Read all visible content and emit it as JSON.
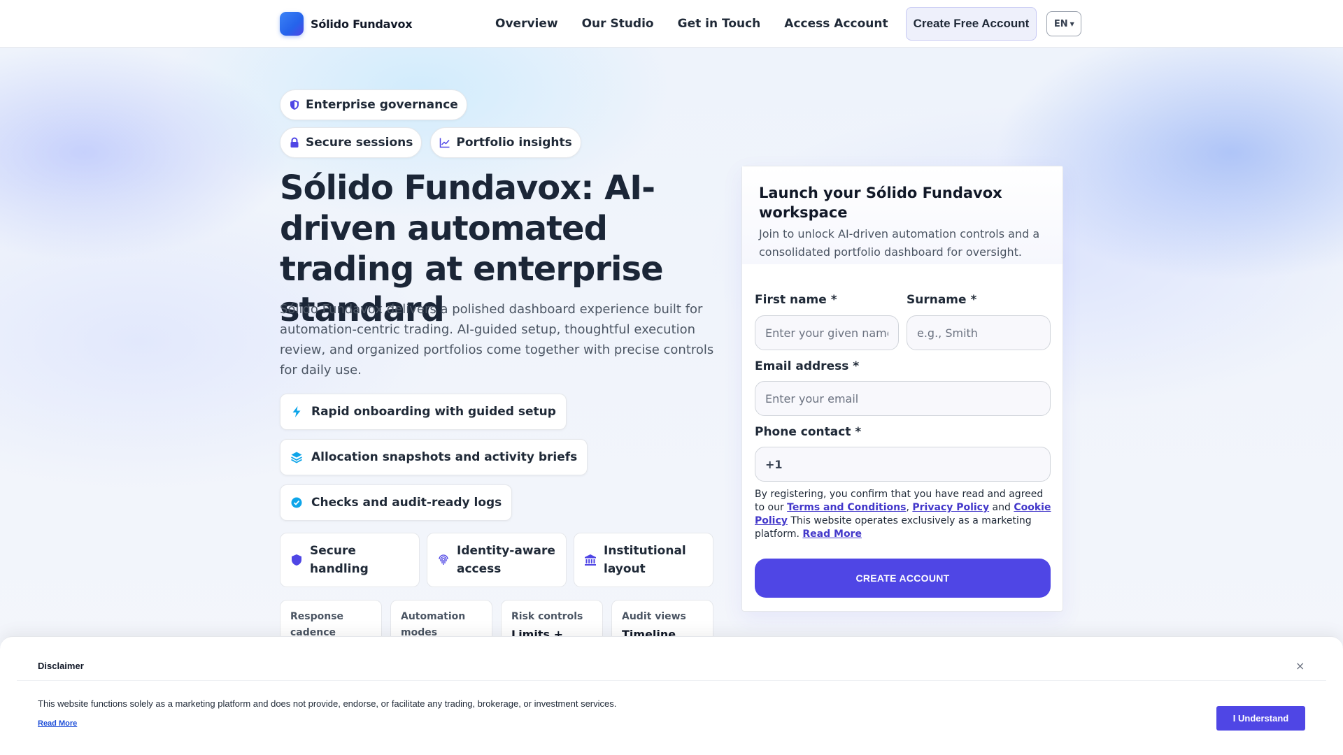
{
  "header": {
    "brand": "Sólido Fundavox",
    "nav": [
      "Overview",
      "Our Studio",
      "Get in Touch",
      "Access Account"
    ],
    "cta": "Create Free Account",
    "language": "EN"
  },
  "hero": {
    "pills": [
      {
        "label": "Enterprise governance",
        "icon": "shield-icon"
      },
      {
        "label": "Secure sessions",
        "icon": "lock-icon"
      },
      {
        "label": "Portfolio insights",
        "icon": "chart-line-icon"
      }
    ],
    "title": "Sólido Fundavox: AI-driven automated trading at enterprise standard",
    "description": "Sólido Fundavox delivers a polished dashboard experience built for automation-centric trading. AI-guided setup, thoughtful execution review, and organized portfolios come together with precise controls for daily use.",
    "features": [
      {
        "label": "Rapid onboarding with guided setup",
        "icon": "bolt-icon"
      },
      {
        "label": "Allocation snapshots and activity briefs",
        "icon": "layers-icon"
      },
      {
        "label": "Checks and audit-ready logs",
        "icon": "check-circle-icon"
      }
    ],
    "trust_cards": [
      {
        "label": "Secure handling",
        "icon": "shield-icon"
      },
      {
        "label": "Identity-aware access",
        "icon": "fingerprint-icon"
      },
      {
        "label": "Institutional layout",
        "icon": "bank-icon"
      }
    ],
    "stat_cards": [
      {
        "label": "Response cadence",
        "value": ""
      },
      {
        "label": "Automation modes",
        "value": ""
      },
      {
        "label": "Risk controls",
        "value": "Limits +"
      },
      {
        "label": "Audit views",
        "value": "Timeline"
      }
    ]
  },
  "form": {
    "title": "Launch your Sólido Fundavox workspace",
    "subtitle": "Join to unlock AI-driven automation controls and a consolidated portfolio dashboard for oversight.",
    "first_name_label": "First name *",
    "first_name_placeholder": "Enter your given name",
    "surname_label": "Surname *",
    "surname_placeholder": "e.g., Smith",
    "email_label": "Email address *",
    "email_placeholder": "Enter your email",
    "phone_label": "Phone contact *",
    "phone_value": "+1",
    "consent_prefix": "By registering, you confirm that you have read and agreed to our ",
    "terms": "Terms and Conditions",
    "comma": ", ",
    "privacy": "Privacy Policy",
    "and": " and ",
    "cookie": "Cookie Policy",
    "consent_suffix": " This website operates exclusively as a marketing platform. ",
    "read_more": "Read More",
    "submit": "CREATE ACCOUNT"
  },
  "disclaimer": {
    "title": "Disclaimer",
    "text": "This website functions solely as a marketing platform and does not provide, endorse, or facilitate any trading, brokerage, or investment services.",
    "read_more": "Read More",
    "button": "I Understand",
    "close": "×"
  },
  "colors": {
    "accent": "#4f46e5",
    "accent_light": "#eef0fb",
    "icon_blue": "#0ea5e9",
    "text_dark": "#1b2637"
  }
}
